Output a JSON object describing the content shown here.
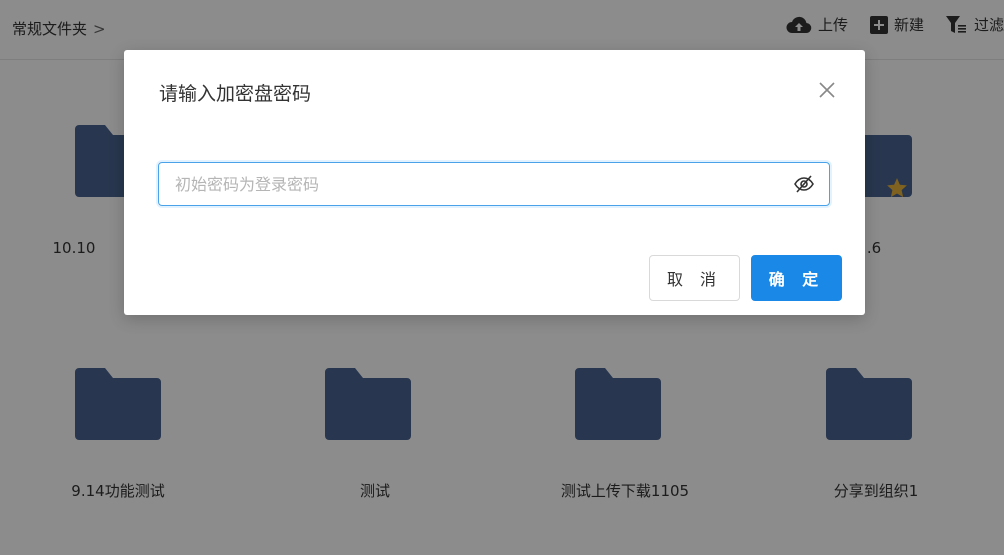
{
  "breadcrumb": {
    "label": "常规文件夹",
    "separator": ">"
  },
  "toolbar": {
    "upload": "上传",
    "new": "新建",
    "filter": "过滤"
  },
  "files": [
    {
      "name": "10.10",
      "starred": false
    },
    {
      "name": "",
      "starred": false
    },
    {
      "name": "",
      "starred": false
    },
    {
      "name": ".6",
      "starred": true
    },
    {
      "name": "9.14功能测试",
      "starred": false
    },
    {
      "name": "测试",
      "starred": false
    },
    {
      "name": "测试上传下载1105",
      "starred": false
    },
    {
      "name": "分享到组织1",
      "starred": false
    }
  ],
  "dialog": {
    "title": "请输入加密盘密码",
    "input_value": "",
    "placeholder": "初始密码为登录密码",
    "cancel": "取 消",
    "confirm": "确 定"
  },
  "colors": {
    "folder": "#4a6591",
    "accent": "#1a88e6",
    "star": "#e8b23b"
  }
}
